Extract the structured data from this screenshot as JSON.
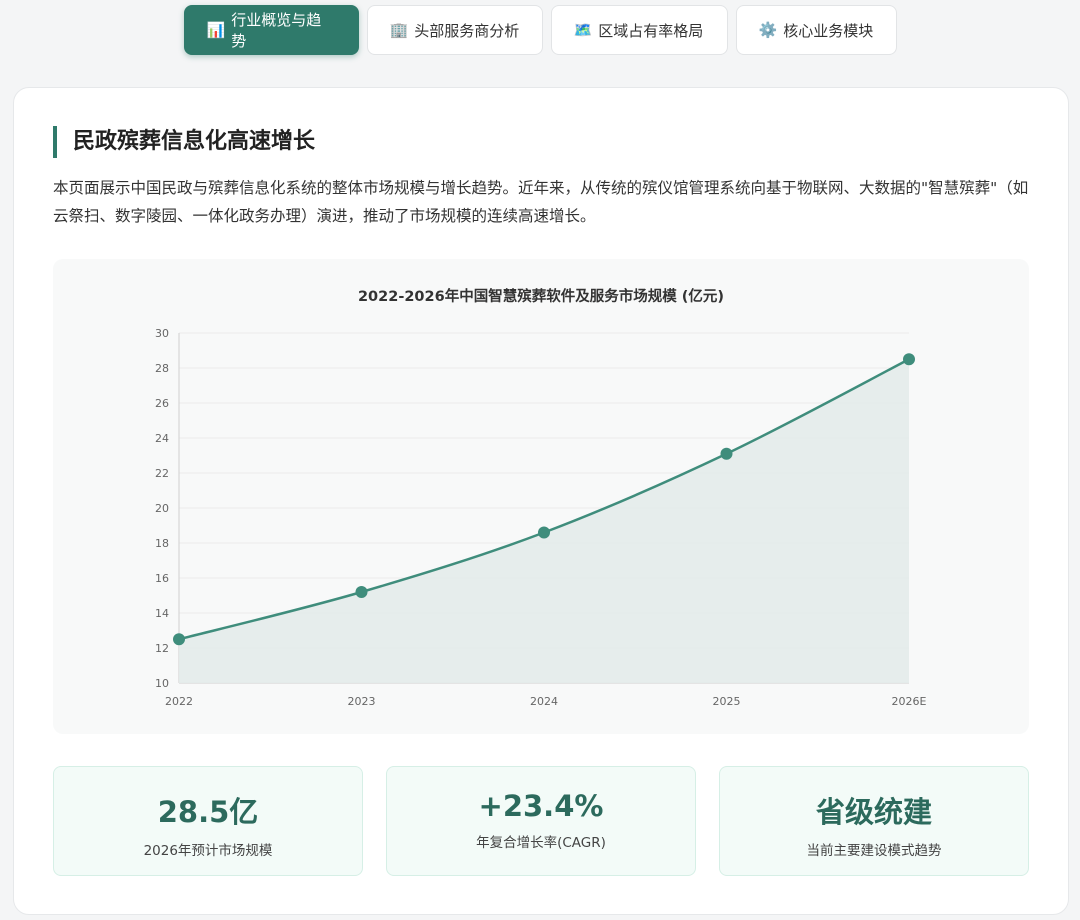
{
  "tabs": [
    {
      "icon": "📊",
      "label": "行业概览与趋势",
      "active": true
    },
    {
      "icon": "🏢",
      "label": "头部服务商分析",
      "active": false
    },
    {
      "icon": "🗺️",
      "label": "区域占有率格局",
      "active": false
    },
    {
      "icon": "⚙️",
      "label": "核心业务模块",
      "active": false
    }
  ],
  "section": {
    "title": "民政殡葬信息化高速增长",
    "description": "本页面展示中国民政与殡葬信息化系统的整体市场规模与增长趋势。近年来，从传统的殡仪馆管理系统向基于物联网、大数据的\"智慧殡葬\"（如云祭扫、数字陵园、一体化政务办理）演进，推动了市场规模的连续高速增长。"
  },
  "chart_data": {
    "type": "area",
    "title": "2022-2026年中国智慧殡葬软件及服务市场规模 (亿元)",
    "categories": [
      "2022",
      "2023",
      "2024",
      "2025",
      "2026E"
    ],
    "series": [
      {
        "values": [
          12.5,
          15.2,
          18.6,
          23.1,
          28.5
        ]
      }
    ],
    "ylim": [
      10,
      30
    ],
    "yticks": [
      10,
      12,
      14,
      16,
      18,
      20,
      22,
      24,
      26,
      28,
      30
    ],
    "grid": true,
    "colors": {
      "line": "#3f8d7c",
      "fill": "#e3ebea",
      "grid": "#ececec"
    }
  },
  "stats": [
    {
      "value": "28.5亿",
      "label": "2026年预计市场规模"
    },
    {
      "value": "+23.4%",
      "label": "年复合增长率(CAGR)"
    },
    {
      "value": "省级统建",
      "label": "当前主要建设模式趋势"
    }
  ]
}
